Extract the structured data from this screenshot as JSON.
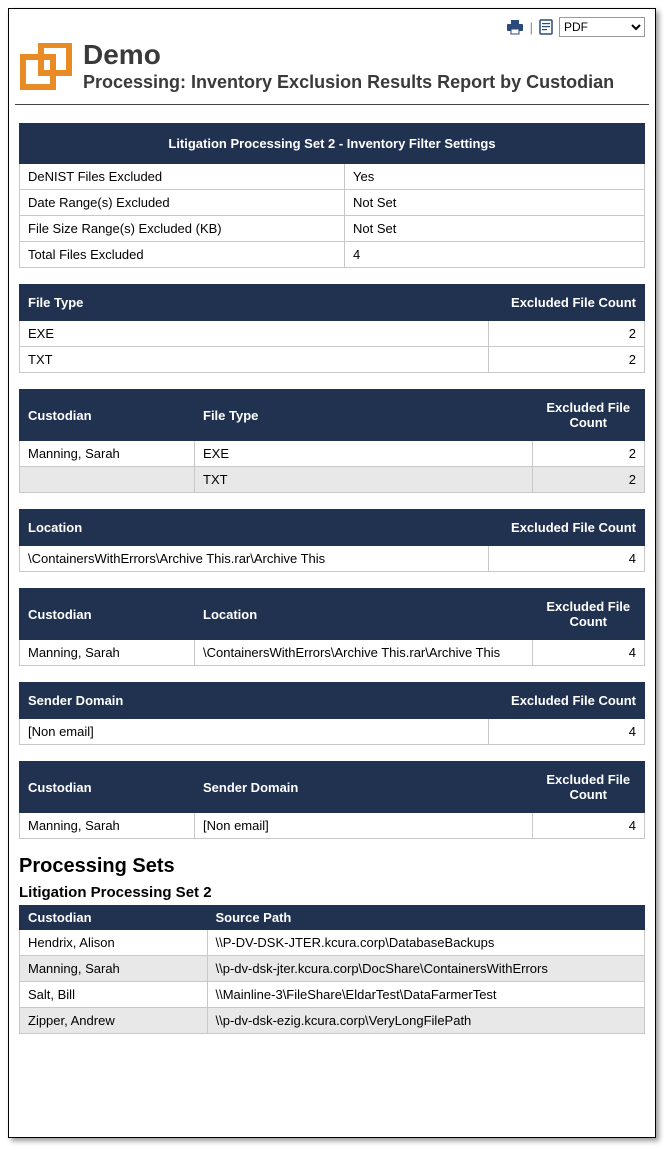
{
  "toolbar": {
    "print_icon": "printer-icon",
    "page_icon": "page-icon",
    "format_selected": "PDF"
  },
  "header": {
    "title": "Demo",
    "subtitle": "Processing: Inventory Exclusion Results Report by Custodian"
  },
  "settings_table": {
    "banner": "Litigation Processing Set 2 - Inventory Filter Settings",
    "rows": [
      {
        "label": "DeNIST Files Excluded",
        "value": "Yes"
      },
      {
        "label": "Date Range(s) Excluded",
        "value": "Not Set"
      },
      {
        "label": "File Size Range(s) Excluded (KB)",
        "value": "Not Set"
      },
      {
        "label": "Total Files Excluded",
        "value": "4"
      }
    ]
  },
  "file_type_table": {
    "headers": {
      "c1": "File Type",
      "c2": "Excluded File Count"
    },
    "rows": [
      {
        "c1": "EXE",
        "c2": "2"
      },
      {
        "c1": "TXT",
        "c2": "2"
      }
    ]
  },
  "custodian_filetype_table": {
    "headers": {
      "c1": "Custodian",
      "c2": "File Type",
      "c3": "Excluded File Count"
    },
    "rows": [
      {
        "c1": "Manning, Sarah",
        "c2": "EXE",
        "c3": "2"
      },
      {
        "c1": "",
        "c2": "TXT",
        "c3": "2",
        "alt": true
      }
    ]
  },
  "location_table": {
    "headers": {
      "c1": "Location",
      "c2": "Excluded File Count"
    },
    "rows": [
      {
        "c1": "\\ContainersWithErrors\\Archive This.rar\\Archive This",
        "c2": "4"
      }
    ]
  },
  "custodian_location_table": {
    "headers": {
      "c1": "Custodian",
      "c2": "Location",
      "c3": "Excluded File Count"
    },
    "rows": [
      {
        "c1": "Manning, Sarah",
        "c2": "\\ContainersWithErrors\\Archive This.rar\\Archive This",
        "c3": "4"
      }
    ]
  },
  "sender_domain_table": {
    "headers": {
      "c1": "Sender Domain",
      "c2": "Excluded File Count"
    },
    "rows": [
      {
        "c1": "[Non email]",
        "c2": "4"
      }
    ]
  },
  "custodian_sender_table": {
    "headers": {
      "c1": "Custodian",
      "c2": "Sender Domain",
      "c3": "Excluded File Count"
    },
    "rows": [
      {
        "c1": "Manning, Sarah",
        "c2": "[Non email]",
        "c3": "4"
      }
    ]
  },
  "processing_sets": {
    "heading": "Processing Sets",
    "subheading": "Litigation Processing Set 2",
    "headers": {
      "c1": "Custodian",
      "c2": "Source Path"
    },
    "rows": [
      {
        "c1": "Hendrix, Alison",
        "c2": "\\\\P-DV-DSK-JTER.kcura.corp\\DatabaseBackups"
      },
      {
        "c1": "Manning, Sarah",
        "c2": "\\\\p-dv-dsk-jter.kcura.corp\\DocShare\\ContainersWithErrors",
        "alt": true
      },
      {
        "c1": "Salt, Bill",
        "c2": "\\\\Mainline-3\\FileShare\\EldarTest\\DataFarmerTest"
      },
      {
        "c1": "Zipper, Andrew",
        "c2": "\\\\p-dv-dsk-ezig.kcura.corp\\VeryLongFilePath",
        "alt": true
      }
    ]
  }
}
